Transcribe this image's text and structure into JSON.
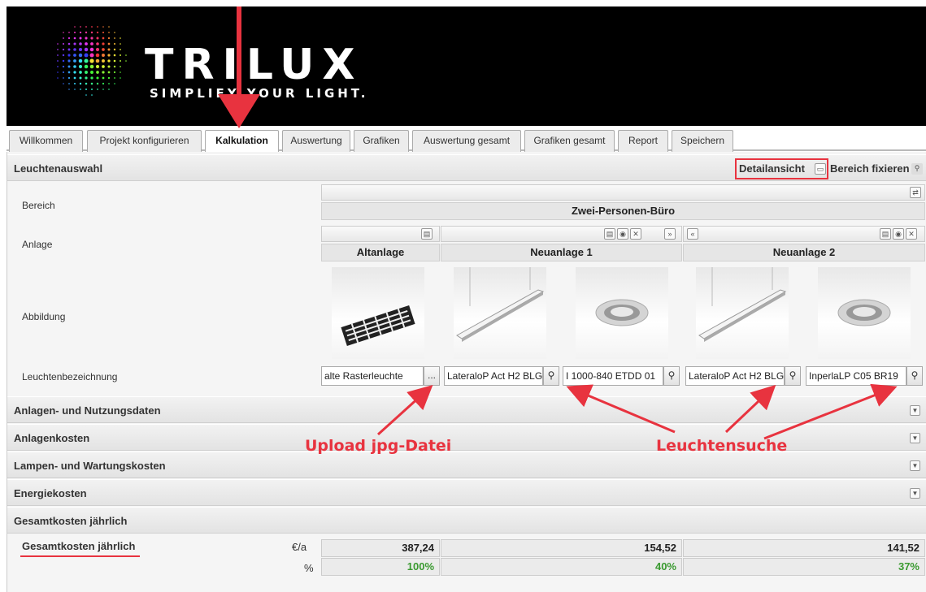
{
  "brand": {
    "name": "TRILUX",
    "tagline": "SIMPLIFY YOUR LIGHT."
  },
  "tabs": [
    {
      "label": "Willkommen"
    },
    {
      "label": "Projekt konfigurieren"
    },
    {
      "label": "Kalkulation",
      "active": true
    },
    {
      "label": "Auswertung"
    },
    {
      "label": "Grafiken"
    },
    {
      "label": "Auswertung gesamt"
    },
    {
      "label": "Grafiken gesamt"
    },
    {
      "label": "Report"
    },
    {
      "label": "Speichern"
    }
  ],
  "leuchtenauswahl": {
    "title": "Leuchtenauswahl",
    "detailansicht": "Detailansicht",
    "bereich_fixieren": "Bereich fixieren",
    "labels": {
      "bereich": "Bereich",
      "anlage": "Anlage",
      "abbildung": "Abbildung",
      "leuchtenbezeichnung": "Leuchtenbezeichnung"
    },
    "bereich_name": "Zwei-Personen-Büro",
    "anlagen": {
      "alt": "Altanlage",
      "neu1": "Neuanlage 1",
      "neu2": "Neuanlage 2"
    },
    "leuchten": [
      "alte Rasterleuchte",
      "LateraloP Act H2 BLG",
      "I 1000-840 ETDD 01",
      "LateraloP Act H2 BLG",
      "InperlaLP C05 BR19"
    ],
    "browse_label": "..."
  },
  "sections": [
    {
      "title": "Anlagen- und Nutzungsdaten"
    },
    {
      "title": "Anlagenkosten"
    },
    {
      "title": "Lampen- und Wartungskosten"
    },
    {
      "title": "Energiekosten"
    },
    {
      "title": "Gesamtkosten jährlich"
    }
  ],
  "gesamtkosten": {
    "label": "Gesamtkosten jährlich",
    "unit_cost": "€/a",
    "unit_pct": "%",
    "costs": [
      "387,24",
      "154,52",
      "141,52"
    ],
    "percents": [
      "100%",
      "40%",
      "37%"
    ]
  },
  "annotations": {
    "upload": "Upload  jpg-Datei",
    "suche": "Leuchtensuche"
  },
  "colors": {
    "accent_red": "#e8333f",
    "percent_green": "#3a9a30"
  }
}
